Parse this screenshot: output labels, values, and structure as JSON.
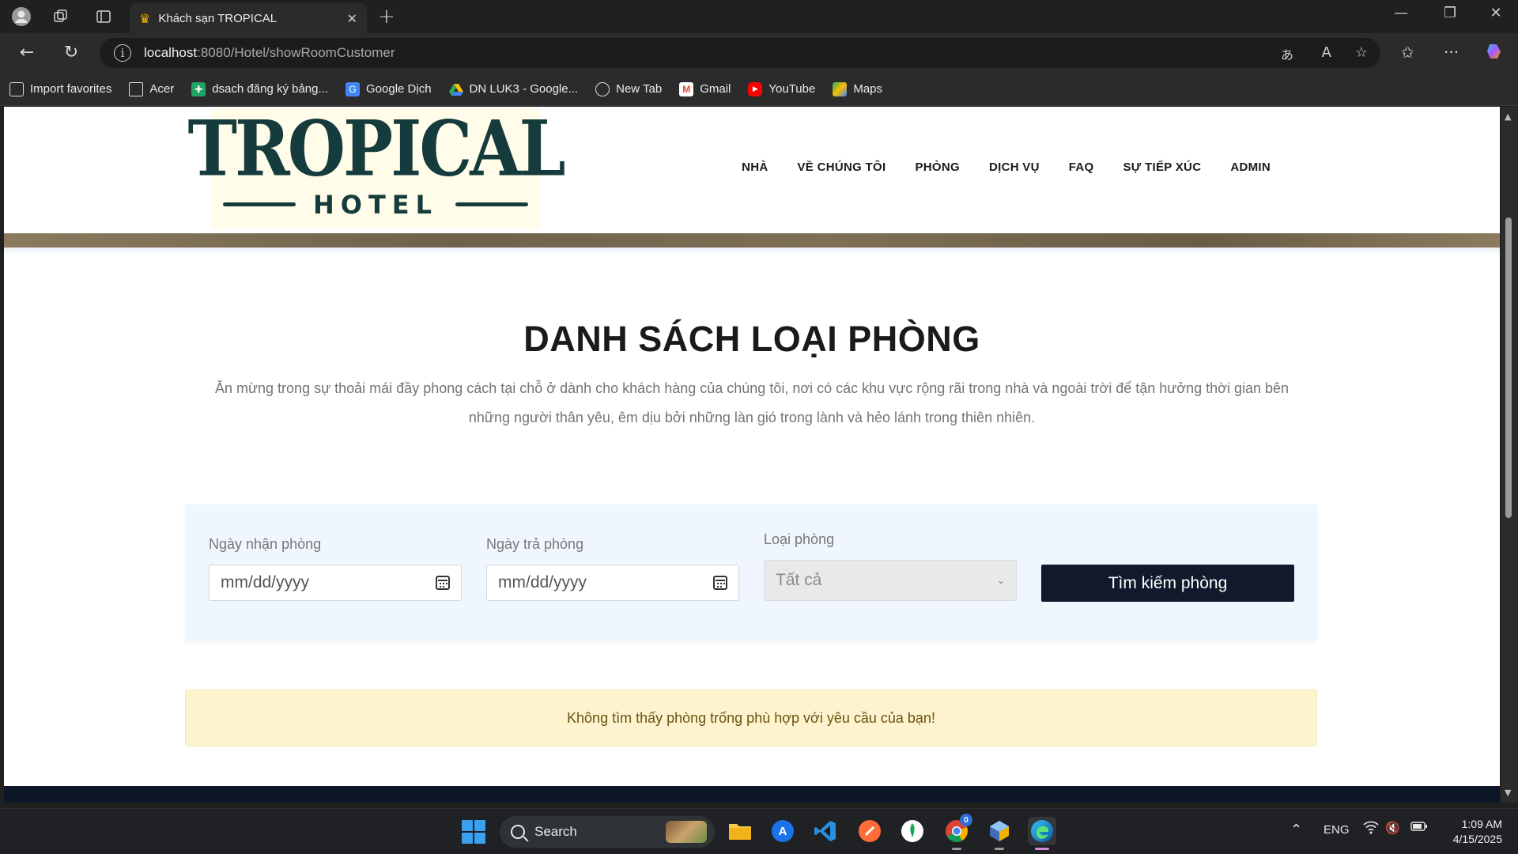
{
  "browser": {
    "tab_title": "Khách sạn TROPICAL",
    "url_host": "localhost",
    "url_path": ":8080/Hotel/showRoomCustomer",
    "bookmarks": [
      {
        "label": "Import favorites",
        "icon": "import-icon"
      },
      {
        "label": "Acer",
        "icon": "folder-icon"
      },
      {
        "label": "dsach đăng ký bảng...",
        "icon": "sheets-icon"
      },
      {
        "label": "Google Dịch",
        "icon": "translate-icon"
      },
      {
        "label": "DN LUK3 - Google...",
        "icon": "drive-icon"
      },
      {
        "label": "New Tab",
        "icon": "globe-icon"
      },
      {
        "label": "Gmail",
        "icon": "gmail-icon"
      },
      {
        "label": "YouTube",
        "icon": "youtube-icon"
      },
      {
        "label": "Maps",
        "icon": "maps-icon"
      }
    ]
  },
  "site": {
    "logo_main": "TROPICAL",
    "logo_sub": "HOTEL",
    "menu": [
      "NHÀ",
      "VỀ CHÚNG TÔI",
      "PHÒNG",
      "DỊCH VỤ",
      "FAQ",
      "SỰ TIẾP XÚC",
      "ADMIN"
    ]
  },
  "section": {
    "title": "DANH SÁCH LOẠI PHÒNG",
    "description": "Ăn mừng trong sự thoải mái đầy phong cách tại chỗ ở dành cho khách hàng của chúng tôi, nơi có các khu vực rộng rãi trong nhà và ngoài trời để tận hưởng thời gian bên những người thân yêu, êm dịu bởi những làn gió trong lành và hẻo lánh trong thiên nhiên."
  },
  "search": {
    "checkin_label": "Ngày nhận phòng",
    "checkin_placeholder": "mm/dd/yyyy",
    "checkout_label": "Ngày trả phòng",
    "checkout_placeholder": "mm/dd/yyyy",
    "room_type_label": "Loại phòng",
    "room_type_value": "Tất cả",
    "button_label": "Tìm kiếm phòng"
  },
  "alert": {
    "message": "Không tìm thấy phòng trống phù hợp với yêu cầu của bạn!"
  },
  "taskbar": {
    "search_label": "Search",
    "language": "ENG",
    "time": "1:09 AM",
    "date": "4/15/2025",
    "chrome_badge": "0"
  },
  "colors": {
    "accent_dark": "#111a2c",
    "logo_green": "#163b3c",
    "alert_bg": "#fdf3cf",
    "search_panel_bg": "#f0f6fd"
  }
}
